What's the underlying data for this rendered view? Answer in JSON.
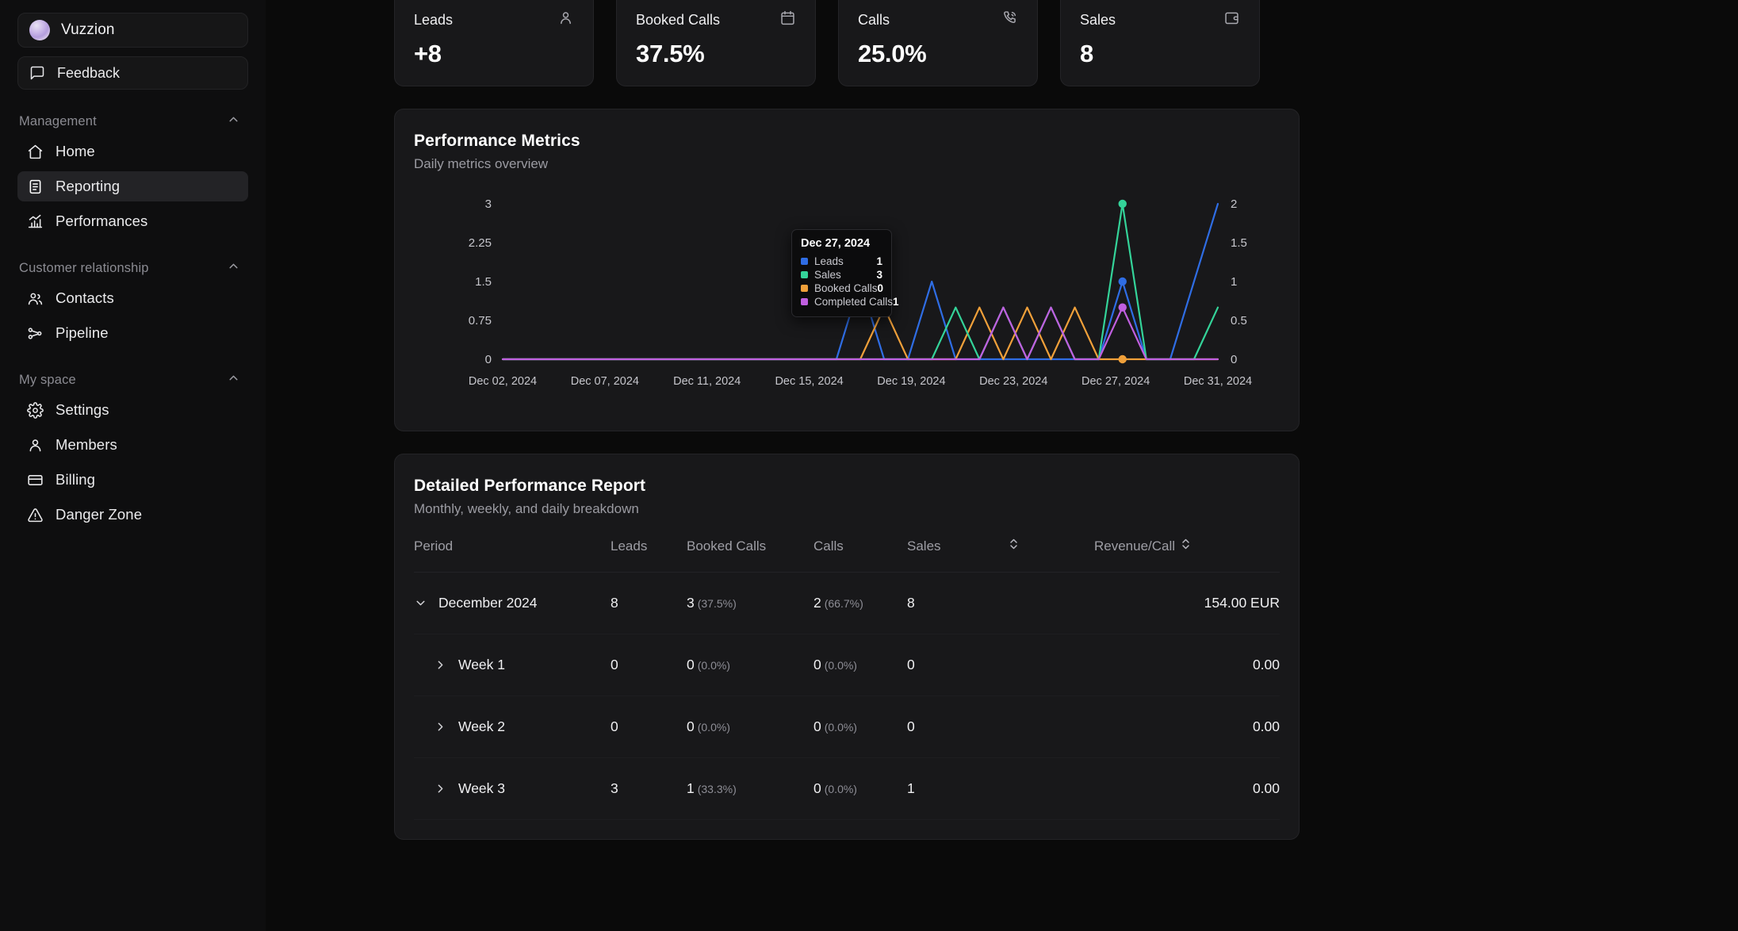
{
  "sidebar": {
    "workspace": {
      "name": "Vuzzion",
      "icon": "avatar"
    },
    "feedback": {
      "label": "Feedback",
      "icon": "message-square-icon"
    },
    "groups": [
      {
        "title": "Management",
        "items": [
          {
            "label": "Home",
            "icon": "home-icon",
            "active": false
          },
          {
            "label": "Reporting",
            "icon": "file-text-icon",
            "active": true
          },
          {
            "label": "Performances",
            "icon": "chart-bar-icon",
            "active": false
          }
        ]
      },
      {
        "title": "Customer relationship",
        "items": [
          {
            "label": "Contacts",
            "icon": "users-icon",
            "active": false
          },
          {
            "label": "Pipeline",
            "icon": "network-icon",
            "active": false
          }
        ]
      },
      {
        "title": "My space",
        "items": [
          {
            "label": "Settings",
            "icon": "gear-icon",
            "active": false
          },
          {
            "label": "Members",
            "icon": "user-icon",
            "active": false
          },
          {
            "label": "Billing",
            "icon": "credit-card-icon",
            "active": false
          },
          {
            "label": "Danger Zone",
            "icon": "alert-triangle-icon",
            "active": false
          }
        ]
      }
    ]
  },
  "kpis": [
    {
      "label": "Leads",
      "value": "+8",
      "icon": "user-icon"
    },
    {
      "label": "Booked Calls",
      "value": "37.5%",
      "icon": "calendar-icon"
    },
    {
      "label": "Calls",
      "value": "25.0%",
      "icon": "phone-icon"
    },
    {
      "label": "Sales",
      "value": "8",
      "icon": "wallet-icon"
    }
  ],
  "performance_panel": {
    "title": "Performance Metrics",
    "subtitle": "Daily metrics overview"
  },
  "tooltip": {
    "date": "Dec 27, 2024",
    "rows": [
      {
        "name": "Leads",
        "value": "1",
        "color": "#2f6de4"
      },
      {
        "name": "Sales",
        "value": "3",
        "color": "#34d399"
      },
      {
        "name": "Booked Calls",
        "value": "0",
        "color": "#f0a03a"
      },
      {
        "name": "Completed Calls",
        "value": "1",
        "color": "#c05fe0"
      }
    ]
  },
  "chart_data": {
    "type": "line",
    "title": "Performance Metrics",
    "subtitle": "Daily metrics overview",
    "xlabel": "",
    "ylabel": "",
    "grid": false,
    "legend": "tooltip",
    "x_tick_labels": [
      "Dec 02, 2024",
      "Dec 07, 2024",
      "Dec 11, 2024",
      "Dec 15, 2024",
      "Dec 19, 2024",
      "Dec 23, 2024",
      "Dec 27, 2024",
      "Dec 31, 2024"
    ],
    "left_axis": {
      "ticks": [
        "0",
        "0.75",
        "1.5",
        "2.25",
        "3"
      ],
      "ylim": [
        0,
        3
      ]
    },
    "right_axis": {
      "ticks": [
        "0",
        "0.5",
        "1",
        "1.5",
        "2"
      ],
      "ylim": [
        0,
        2
      ]
    },
    "x": [
      "Dec 01",
      "Dec 02",
      "Dec 03",
      "Dec 04",
      "Dec 05",
      "Dec 06",
      "Dec 07",
      "Dec 08",
      "Dec 09",
      "Dec 10",
      "Dec 11",
      "Dec 12",
      "Dec 13",
      "Dec 14",
      "Dec 15",
      "Dec 16",
      "Dec 17",
      "Dec 18",
      "Dec 19",
      "Dec 20",
      "Dec 21",
      "Dec 22",
      "Dec 23",
      "Dec 24",
      "Dec 25",
      "Dec 26",
      "Dec 27",
      "Dec 28",
      "Dec 29",
      "Dec 30",
      "Dec 31"
    ],
    "series": [
      {
        "name": "Leads",
        "color": "#2f6de4",
        "axis": "right",
        "values": [
          0,
          0,
          0,
          0,
          0,
          0,
          0,
          0,
          0,
          0,
          0,
          0,
          0,
          0,
          0,
          1,
          0,
          0,
          1,
          0,
          0,
          0,
          0,
          0,
          0,
          0,
          1,
          0,
          0,
          1,
          2
        ]
      },
      {
        "name": "Sales",
        "color": "#34d399",
        "axis": "left",
        "values": [
          0,
          0,
          0,
          0,
          0,
          0,
          0,
          0,
          0,
          0,
          0,
          0,
          0,
          0,
          0,
          0,
          0,
          0,
          0,
          1,
          0,
          1,
          0,
          1,
          0,
          0,
          3,
          0,
          0,
          0,
          1
        ]
      },
      {
        "name": "Booked Calls",
        "color": "#f0a03a",
        "axis": "left",
        "values": [
          0,
          0,
          0,
          0,
          0,
          0,
          0,
          0,
          0,
          0,
          0,
          0,
          0,
          0,
          0,
          0,
          1,
          0,
          0,
          0,
          1,
          0,
          1,
          0,
          1,
          0,
          0,
          0,
          0,
          0,
          0
        ]
      },
      {
        "name": "Completed Calls",
        "color": "#c05fe0",
        "axis": "left",
        "values": [
          0,
          0,
          0,
          0,
          0,
          0,
          0,
          0,
          0,
          0,
          0,
          0,
          0,
          0,
          0,
          0,
          0,
          0,
          0,
          0,
          0,
          1,
          0,
          1,
          0,
          0,
          1,
          0,
          0,
          0,
          0
        ]
      }
    ]
  },
  "report_panel": {
    "title": "Detailed Performance Report",
    "subtitle": "Monthly, weekly, and daily breakdown",
    "columns": [
      {
        "key": "period",
        "label": "Period",
        "sortable": false
      },
      {
        "key": "leads",
        "label": "Leads",
        "sortable": false
      },
      {
        "key": "booked_calls",
        "label": "Booked Calls",
        "sortable": false
      },
      {
        "key": "calls",
        "label": "Calls",
        "sortable": false
      },
      {
        "key": "sales",
        "label": "Sales",
        "sortable": true
      },
      {
        "key": "revenue_per_call",
        "label": "Revenue/Call",
        "sortable": true
      }
    ],
    "rows": [
      {
        "period": "December 2024",
        "level": 0,
        "expanded": true,
        "leads": "8",
        "booked_calls": "3",
        "booked_calls_pct": "(37.5%)",
        "calls": "2",
        "calls_pct": "(66.7%)",
        "sales": "8",
        "revenue_per_call": "154.00 EUR"
      },
      {
        "period": "Week 1",
        "level": 1,
        "expanded": false,
        "leads": "0",
        "booked_calls": "0",
        "booked_calls_pct": "(0.0%)",
        "calls": "0",
        "calls_pct": "(0.0%)",
        "sales": "0",
        "revenue_per_call": "0.00"
      },
      {
        "period": "Week 2",
        "level": 1,
        "expanded": false,
        "leads": "0",
        "booked_calls": "0",
        "booked_calls_pct": "(0.0%)",
        "calls": "0",
        "calls_pct": "(0.0%)",
        "sales": "0",
        "revenue_per_call": "0.00"
      },
      {
        "period": "Week 3",
        "level": 1,
        "expanded": false,
        "leads": "3",
        "booked_calls": "1",
        "booked_calls_pct": "(33.3%)",
        "calls": "0",
        "calls_pct": "(0.0%)",
        "sales": "1",
        "revenue_per_call": "0.00"
      }
    ]
  },
  "colors": {
    "page_bg": "#0a0a0a",
    "sidebar_bg": "#0e0e0f",
    "card_bg": "#18181a",
    "border": "#242427",
    "text_primary": "#f0f0f2",
    "text_muted": "#9b9ba2"
  }
}
